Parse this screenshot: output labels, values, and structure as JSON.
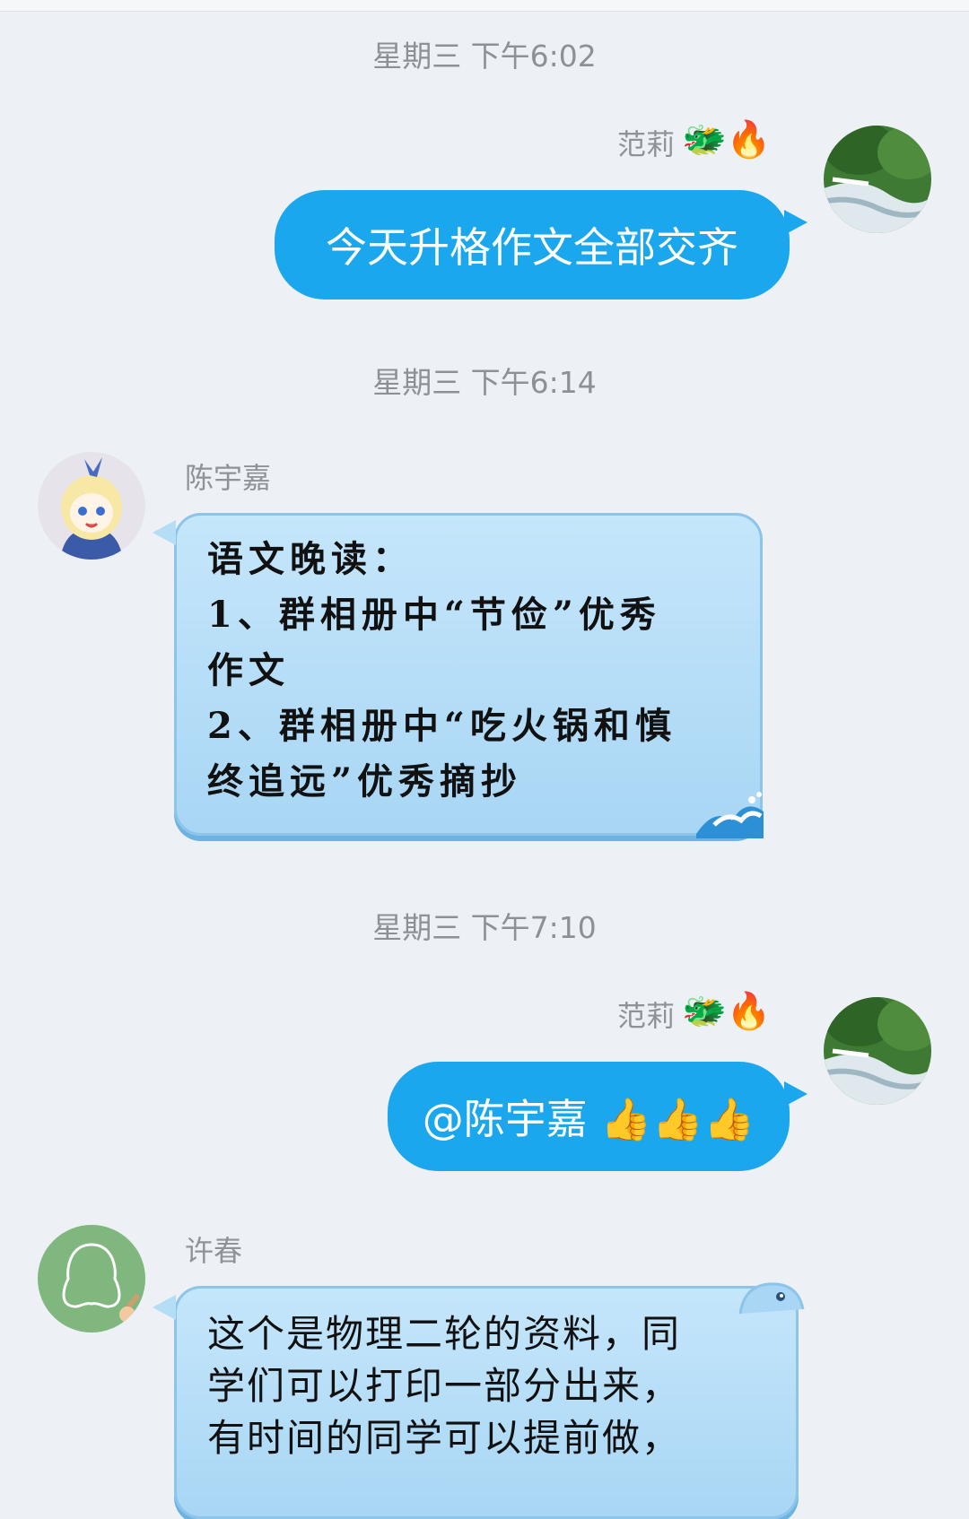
{
  "timestamps": [
    "星期三 下午6:02",
    "星期三 下午6:14",
    "星期三 下午7:10"
  ],
  "messages": [
    {
      "sender": "范莉",
      "badges": "🐲🔥",
      "text": "今天升格作文全部交齐"
    },
    {
      "sender": "陈宇嘉",
      "lines": [
        "语文晚读：",
        "1、群相册中“节俭”优秀",
        "作文",
        "2、群相册中“吃火锅和慎",
        "终追远”优秀摘抄"
      ]
    },
    {
      "sender": "范莉",
      "badges": "🐲🔥",
      "text": "@陈宇嘉 👍👍👍"
    },
    {
      "sender": "许春",
      "lines": [
        "这个是物理二轮的资料，同",
        "学们可以打印一部分出来，",
        "有时间的同学可以提前做，"
      ]
    }
  ],
  "colors": {
    "bubble_blue": "#1aa7ee",
    "cloud_bubble": "#b6ddf6",
    "background": "#edf0f5"
  }
}
